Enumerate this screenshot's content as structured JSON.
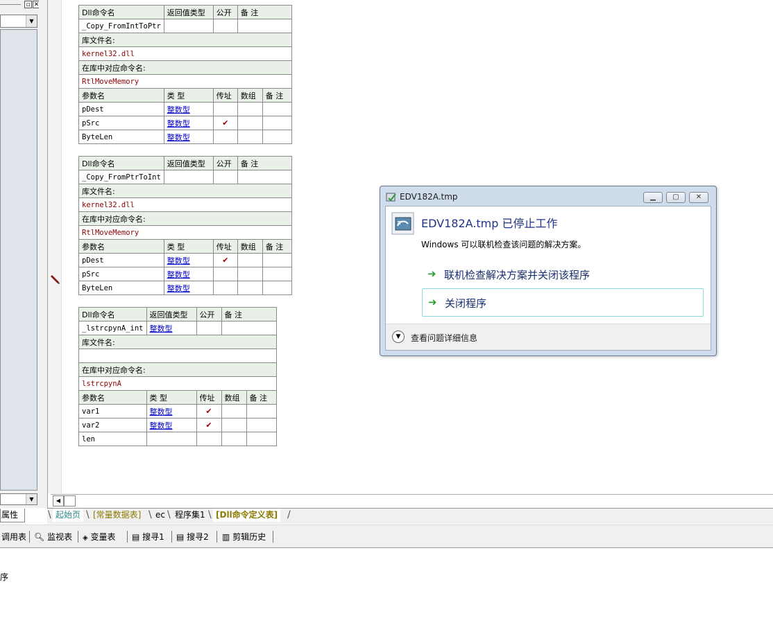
{
  "left_panel": {
    "tab_label": "属性"
  },
  "tables": [
    {
      "header": [
        "Dll命令名",
        "返回值类型",
        "公开",
        "备 注"
      ],
      "row": {
        "name": "_Copy_FromIntToPtr",
        "return_type": "",
        "public": false,
        "note": ""
      },
      "lib_label": "库文件名:",
      "lib": "kernel32.dll",
      "entry_label": "在库中对应命令名:",
      "entry": "RtlMoveMemory",
      "param_header": [
        "参数名",
        "类 型",
        "传址",
        "数组",
        "备 注"
      ],
      "params": [
        {
          "name": "pDest",
          "type": "整数型",
          "by_ref": false
        },
        {
          "name": "pSrc",
          "type": "整数型",
          "by_ref": true
        },
        {
          "name": "ByteLen",
          "type": "整数型",
          "by_ref": false
        }
      ]
    },
    {
      "header": [
        "Dll命令名",
        "返回值类型",
        "公开",
        "备 注"
      ],
      "row": {
        "name": "_Copy_FromPtrToInt",
        "return_type": "",
        "public": false,
        "note": ""
      },
      "lib_label": "库文件名:",
      "lib": "kernel32.dll",
      "entry_label": "在库中对应命令名:",
      "entry": "RtlMoveMemory",
      "param_header": [
        "参数名",
        "类 型",
        "传址",
        "数组",
        "备 注"
      ],
      "params": [
        {
          "name": "pDest",
          "type": "整数型",
          "by_ref": true
        },
        {
          "name": "pSrc",
          "type": "整数型",
          "by_ref": false
        },
        {
          "name": "ByteLen",
          "type": "整数型",
          "by_ref": false
        }
      ]
    },
    {
      "header": [
        "Dll命令名",
        "返回值类型",
        "公开",
        "备 注"
      ],
      "row": {
        "name": "_lstrcpynA_int",
        "return_type": "整数型",
        "public": false,
        "note": ""
      },
      "lib_label": "库文件名:",
      "lib": "",
      "entry_label": "在库中对应命令名:",
      "entry": "lstrcpynA",
      "param_header": [
        "参数名",
        "类 型",
        "传址",
        "数组",
        "备 注"
      ],
      "params": [
        {
          "name": "var1",
          "type": "整数型",
          "by_ref": true
        },
        {
          "name": "var2",
          "type": "整数型",
          "by_ref": true
        },
        {
          "name": "len",
          "type": "",
          "by_ref": false
        }
      ]
    }
  ],
  "tabs": [
    "起始页",
    "[常量数据表]",
    "ec",
    "程序集1",
    "[Dll命令定义表]"
  ],
  "bottom_toolbar": [
    "调用表",
    "监视表",
    "变量表",
    "搜寻1",
    "搜寻2",
    "剪辑历史"
  ],
  "output_text": "序",
  "dialog": {
    "title": "EDV182A.tmp",
    "heading": "EDV182A.tmp 已停止工作",
    "subtext": "Windows 可以联机检查该问题的解决方案。",
    "option1": "联机检查解决方案并关闭该程序",
    "option2": "关闭程序",
    "details": "查看问题详细信息"
  },
  "colors": {
    "table_header_bg": "#e8f0e8",
    "link_blue": "#0000cc",
    "dark_red": "#8b0000",
    "dialog_heading": "#1e3287",
    "arrow_green": "#2f9e3a",
    "active_tab_teal": "#2a8c8c",
    "highlight_tab_olive": "#8b7a00"
  },
  "icons": [
    "minimize-icon",
    "maximize-icon",
    "close-icon",
    "check-icon",
    "arrow-right-icon",
    "chevron-down-icon",
    "search-icon",
    "watch-icon",
    "variables-icon",
    "history-icon",
    "breakpoint-marker-icon",
    "app-error-icon"
  ]
}
